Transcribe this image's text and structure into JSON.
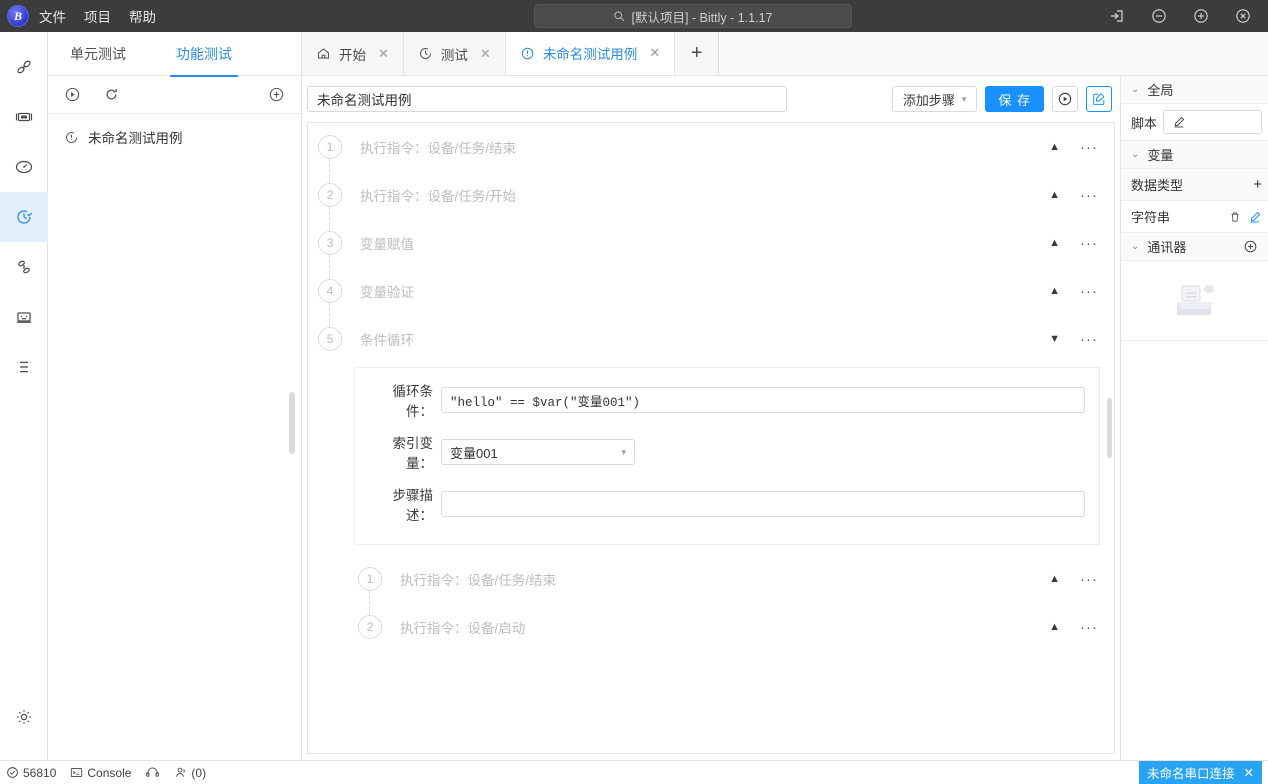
{
  "titlebar": {
    "logo_text": "B",
    "menus": [
      {
        "label": "文件",
        "name": "menu-file"
      },
      {
        "label": "项目",
        "name": "menu-project"
      },
      {
        "label": "帮助",
        "name": "menu-help"
      }
    ],
    "search_text": "[默认项目] - Bittly - 1.1.17",
    "window_controls": [
      "login-icon",
      "minimize-icon",
      "maximize-icon",
      "close-icon"
    ]
  },
  "rail": {
    "items": [
      {
        "icon": "link-chain-icon",
        "active": false
      },
      {
        "icon": "panel-icon",
        "active": false
      },
      {
        "icon": "dashboard-icon",
        "active": false
      },
      {
        "icon": "test-clock-icon",
        "active": true
      },
      {
        "icon": "flow-icon",
        "active": false
      },
      {
        "icon": "monitor-icon",
        "active": false
      },
      {
        "icon": "layers-icon",
        "active": false
      }
    ],
    "settings_icon": "gear-icon"
  },
  "sidebar": {
    "tabs": [
      {
        "label": "单元测试",
        "active": false
      },
      {
        "label": "功能测试",
        "active": true
      }
    ],
    "toolbar": [
      {
        "icon": "play-circle-icon"
      },
      {
        "icon": "refresh-icon"
      },
      {
        "icon": "plus-circle-icon"
      }
    ],
    "items": [
      {
        "icon": "test-case-icon",
        "label": "未命名测试用例"
      }
    ]
  },
  "tabs": [
    {
      "label": "开始",
      "icon": "home-icon",
      "active": false,
      "closable": true
    },
    {
      "label": "测试",
      "icon": "clock-icon",
      "active": false,
      "closable": true
    },
    {
      "label": "未命名测试用例",
      "icon": "test-clock-icon",
      "active": true,
      "closable": true
    }
  ],
  "tab_add_label": "+",
  "editor": {
    "title_value": "未命名测试用例",
    "title_placeholder": "测试用例名称",
    "add_step_label": "添加步骤",
    "save_label": "保 存",
    "run_icon": "play-circle-icon",
    "edit_icon": "edit-square-icon",
    "steps": [
      {
        "num": "1",
        "label": "执行指令：设备/任务/结束",
        "expanded": false,
        "toggle": "▲"
      },
      {
        "num": "2",
        "label": "执行指令：设备/任务/开始",
        "expanded": false,
        "toggle": "▲"
      },
      {
        "num": "3",
        "label": "变量赋值",
        "expanded": false,
        "toggle": "▲"
      },
      {
        "num": "4",
        "label": "变量验证",
        "expanded": false,
        "toggle": "▲"
      },
      {
        "num": "5",
        "label": "条件循环",
        "expanded": true,
        "toggle": "▼"
      }
    ],
    "loop_form": {
      "condition_label": "循环条件：",
      "condition_value": "\"hello\" == $var(\"变量001\")",
      "index_label": "索引变量：",
      "index_value": "变量001",
      "desc_label": "步骤描述：",
      "desc_value": "",
      "desc_placeholder": ""
    },
    "substeps": [
      {
        "num": "1",
        "label": "执行指令：设备/任务/结束",
        "toggle": "▲"
      },
      {
        "num": "2",
        "label": "执行指令：设备/启动",
        "toggle": "▲"
      }
    ],
    "menu_dots": "···"
  },
  "right_panel": {
    "global": {
      "title": "全局",
      "script_label": "脚本",
      "script_btn_icon": "edit-pencil-icon"
    },
    "variables": {
      "title": "变量",
      "col_header": "数据类型",
      "add_label": "+",
      "rows": [
        {
          "type": "字符串",
          "delete_icon": "trash-icon",
          "edit_icon": "edit-pencil-icon"
        }
      ]
    },
    "communicator": {
      "title": "通讯器",
      "add_icon": "plus-circle-icon",
      "empty_icon": "empty-inbox-icon"
    }
  },
  "statusbar": {
    "memory": "56810",
    "memory_icon": "check-circle-icon",
    "console_label": "Console",
    "console_icon": "terminal-icon",
    "support_icon": "headset-icon",
    "users_label": "(0)",
    "users_icon": "people-icon",
    "connection_label": "未命名串口连接",
    "connection_close": "✕"
  },
  "colors": {
    "accent": "#1890ff",
    "titlebar_bg": "#3c3c3c",
    "active_rail_bg": "#e3f1fd",
    "status_badge": "#29a3f5"
  }
}
